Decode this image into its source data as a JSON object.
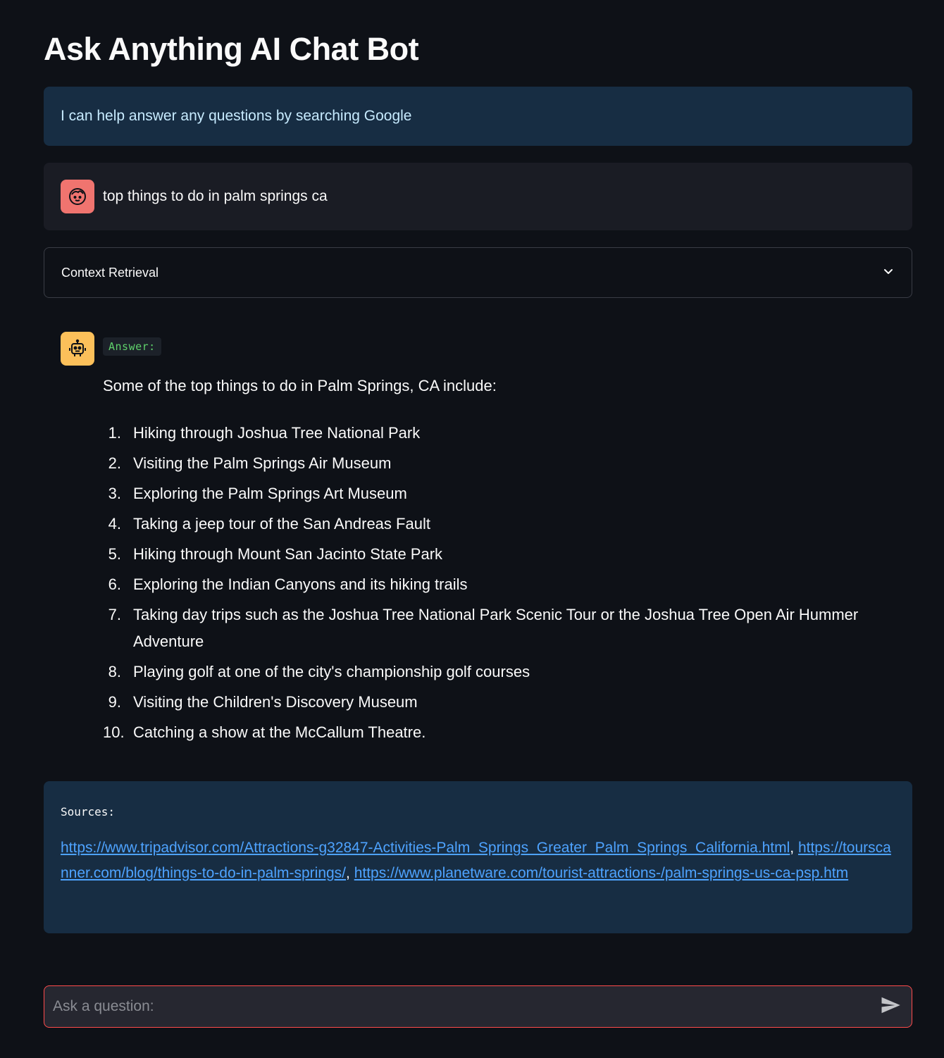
{
  "app": {
    "title": "Ask Anything AI Chat Bot"
  },
  "info": {
    "text": "I can help answer any questions by searching Google"
  },
  "user_message": {
    "text": "top things to do in palm springs ca",
    "avatar_icon": "user-face-icon"
  },
  "expander": {
    "label": "Context Retrieval",
    "icon": "chevron-down-icon"
  },
  "bot_message": {
    "avatar_icon": "robot-icon",
    "badge": "Answer:",
    "intro": "Some of the top things to do in Palm Springs, CA include:",
    "items": [
      {
        "num": "1.",
        "text": "Hiking through Joshua Tree National Park"
      },
      {
        "num": "2.",
        "text": "Visiting the Palm Springs Air Museum"
      },
      {
        "num": "3.",
        "text": "Exploring the Palm Springs Art Museum"
      },
      {
        "num": "4.",
        "text": "Taking a jeep tour of the San Andreas Fault"
      },
      {
        "num": "5.",
        "text": "Hiking through Mount San Jacinto State Park"
      },
      {
        "num": "6.",
        "text": "Exploring the Indian Canyons and its hiking trails"
      },
      {
        "num": "7.",
        "text": "Taking day trips such as the Joshua Tree National Park Scenic Tour or the Joshua Tree Open Air Hummer Adventure"
      },
      {
        "num": "8.",
        "text": "Playing golf at one of the city's championship golf courses"
      },
      {
        "num": "9.",
        "text": "Visiting the Children's Discovery Museum"
      },
      {
        "num": "10.",
        "text": "Catching a show at the McCallum Theatre."
      }
    ]
  },
  "sources": {
    "label": "Sources:",
    "links": [
      "https://www.tripadvisor.com/Attractions-g32847-Activities-Palm_Springs_Greater_Palm_Springs_California.html",
      "https://tourscanner.com/blog/things-to-do-in-palm-springs/",
      "https://www.planetware.com/tourist-attractions-/palm-springs-us-ca-psp.htm"
    ],
    "separator": ", "
  },
  "chat_input": {
    "placeholder": "Ask a question:",
    "value": "",
    "send_icon": "send-icon"
  },
  "colors": {
    "background": "#0e1117",
    "info_bg": "#172d43",
    "user_avatar": "#f0746f",
    "bot_avatar": "#fcc05a",
    "link": "#4ea3ff",
    "input_border": "#ff4b4b",
    "badge_text": "#5fd16b"
  }
}
